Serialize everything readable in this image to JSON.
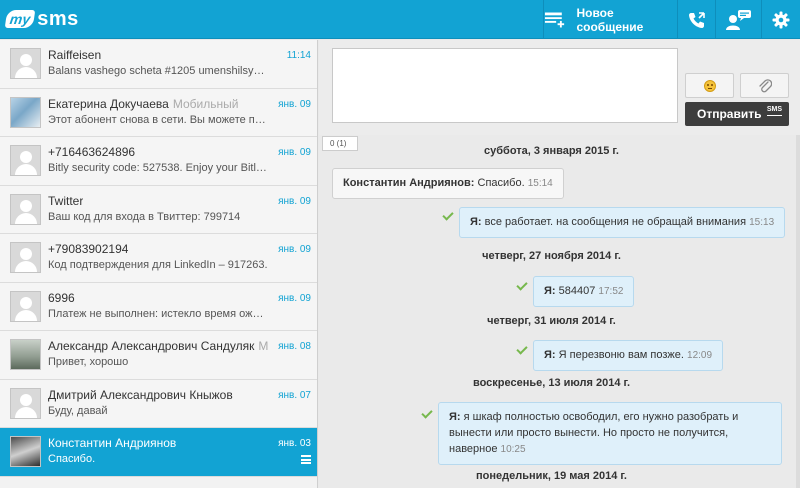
{
  "header": {
    "logo_my": "my",
    "logo_sms": "sms",
    "new_message_label": "Новое сообщение",
    "icons": [
      "new-message-icon",
      "phone-icon",
      "contacts-icon",
      "gear-icon"
    ],
    "accent": "#12a3d3"
  },
  "contacts": [
    {
      "name": "Raiffeisen",
      "type": "",
      "preview": "Balans vashego scheta #1205 umenshilsya 1...",
      "time": "11:14",
      "avatar": "default"
    },
    {
      "name": "Екатерина Докучаева",
      "type": "Мобильный",
      "preview": "Этот абонент снова в сети. Вы можете поз...",
      "time": "янв. 09",
      "avatar": "photo"
    },
    {
      "name": "+716463624896",
      "type": "",
      "preview": "Bitly security code: 527538. Enjoy your Bitlink...",
      "time": "янв. 09",
      "avatar": "default"
    },
    {
      "name": "Twitter",
      "type": "",
      "preview": "Ваш код для входа в Твиттер: 799714",
      "time": "янв. 09",
      "avatar": "default"
    },
    {
      "name": "+79083902194",
      "type": "",
      "preview": "Код подтверждения для LinkedIn – 917263.",
      "time": "янв. 09",
      "avatar": "default"
    },
    {
      "name": "6996",
      "type": "",
      "preview": "Платеж не выполнен: истекло время ожид...",
      "time": "янв. 09",
      "avatar": "default"
    },
    {
      "name": "Александр Александрович Сандуляк",
      "type": "М...",
      "preview": "Привет, хорошо",
      "time": "янв. 08",
      "avatar": "photo"
    },
    {
      "name": "Дмитрий Александрович Кныжов",
      "type": "",
      "preview": "Буду, давай",
      "time": "янв. 07",
      "avatar": "default"
    },
    {
      "name": "Константин Андриянов",
      "type": "",
      "preview": "Спасибо.",
      "time": "янв. 03",
      "avatar": "photo"
    }
  ],
  "composer": {
    "input_value": "",
    "send_label": "Отправить",
    "sms_badge": "SMS",
    "char_count": "0 (1)"
  },
  "thread": {
    "dates": [
      "суббота, 3 января 2015 г.",
      "четверг, 27 ноября 2014 г.",
      "четверг, 31 июля 2014 г.",
      "воскресенье, 13 июля 2014 г.",
      "понедельник, 19 мая 2014 г."
    ],
    "messages": [
      {
        "sender": "Константин Андриянов:",
        "text": "Спасибо.",
        "time": "15:14"
      },
      {
        "sender": "Я:",
        "text": "все работает. на сообщения не обращай внимания",
        "time": "15:13"
      },
      {
        "sender": "Я:",
        "text": "584407",
        "time": "17:52"
      },
      {
        "sender": "Я:",
        "text": "Я перезвоню вам позже.",
        "time": "12:09"
      },
      {
        "sender": "Я:",
        "text": "я шкаф полностью освободил, его нужно разобрать и вынести или просто вынести. Но просто не получится, наверное",
        "time": "10:25"
      }
    ]
  }
}
